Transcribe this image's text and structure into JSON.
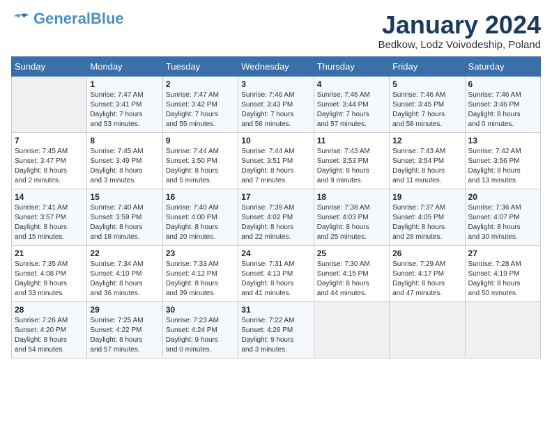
{
  "logo": {
    "general": "General",
    "blue": "Blue"
  },
  "title": "January 2024",
  "subtitle": "Bedkow, Lodz Voivodeship, Poland",
  "weekdays": [
    "Sunday",
    "Monday",
    "Tuesday",
    "Wednesday",
    "Thursday",
    "Friday",
    "Saturday"
  ],
  "weeks": [
    [
      {
        "day": "",
        "info": ""
      },
      {
        "day": "1",
        "info": "Sunrise: 7:47 AM\nSunset: 3:41 PM\nDaylight: 7 hours\nand 53 minutes."
      },
      {
        "day": "2",
        "info": "Sunrise: 7:47 AM\nSunset: 3:42 PM\nDaylight: 7 hours\nand 55 minutes."
      },
      {
        "day": "3",
        "info": "Sunrise: 7:46 AM\nSunset: 3:43 PM\nDaylight: 7 hours\nand 56 minutes."
      },
      {
        "day": "4",
        "info": "Sunrise: 7:46 AM\nSunset: 3:44 PM\nDaylight: 7 hours\nand 57 minutes."
      },
      {
        "day": "5",
        "info": "Sunrise: 7:46 AM\nSunset: 3:45 PM\nDaylight: 7 hours\nand 58 minutes."
      },
      {
        "day": "6",
        "info": "Sunrise: 7:46 AM\nSunset: 3:46 PM\nDaylight: 8 hours\nand 0 minutes."
      }
    ],
    [
      {
        "day": "7",
        "info": "Sunrise: 7:45 AM\nSunset: 3:47 PM\nDaylight: 8 hours\nand 2 minutes."
      },
      {
        "day": "8",
        "info": "Sunrise: 7:45 AM\nSunset: 3:49 PM\nDaylight: 8 hours\nand 3 minutes."
      },
      {
        "day": "9",
        "info": "Sunrise: 7:44 AM\nSunset: 3:50 PM\nDaylight: 8 hours\nand 5 minutes."
      },
      {
        "day": "10",
        "info": "Sunrise: 7:44 AM\nSunset: 3:51 PM\nDaylight: 8 hours\nand 7 minutes."
      },
      {
        "day": "11",
        "info": "Sunrise: 7:43 AM\nSunset: 3:53 PM\nDaylight: 8 hours\nand 9 minutes."
      },
      {
        "day": "12",
        "info": "Sunrise: 7:43 AM\nSunset: 3:54 PM\nDaylight: 8 hours\nand 11 minutes."
      },
      {
        "day": "13",
        "info": "Sunrise: 7:42 AM\nSunset: 3:56 PM\nDaylight: 8 hours\nand 13 minutes."
      }
    ],
    [
      {
        "day": "14",
        "info": "Sunrise: 7:41 AM\nSunset: 3:57 PM\nDaylight: 8 hours\nand 15 minutes."
      },
      {
        "day": "15",
        "info": "Sunrise: 7:40 AM\nSunset: 3:59 PM\nDaylight: 8 hours\nand 18 minutes."
      },
      {
        "day": "16",
        "info": "Sunrise: 7:40 AM\nSunset: 4:00 PM\nDaylight: 8 hours\nand 20 minutes."
      },
      {
        "day": "17",
        "info": "Sunrise: 7:39 AM\nSunset: 4:02 PM\nDaylight: 8 hours\nand 22 minutes."
      },
      {
        "day": "18",
        "info": "Sunrise: 7:38 AM\nSunset: 4:03 PM\nDaylight: 8 hours\nand 25 minutes."
      },
      {
        "day": "19",
        "info": "Sunrise: 7:37 AM\nSunset: 4:05 PM\nDaylight: 8 hours\nand 28 minutes."
      },
      {
        "day": "20",
        "info": "Sunrise: 7:36 AM\nSunset: 4:07 PM\nDaylight: 8 hours\nand 30 minutes."
      }
    ],
    [
      {
        "day": "21",
        "info": "Sunrise: 7:35 AM\nSunset: 4:08 PM\nDaylight: 8 hours\nand 33 minutes."
      },
      {
        "day": "22",
        "info": "Sunrise: 7:34 AM\nSunset: 4:10 PM\nDaylight: 8 hours\nand 36 minutes."
      },
      {
        "day": "23",
        "info": "Sunrise: 7:33 AM\nSunset: 4:12 PM\nDaylight: 8 hours\nand 39 minutes."
      },
      {
        "day": "24",
        "info": "Sunrise: 7:31 AM\nSunset: 4:13 PM\nDaylight: 8 hours\nand 41 minutes."
      },
      {
        "day": "25",
        "info": "Sunrise: 7:30 AM\nSunset: 4:15 PM\nDaylight: 8 hours\nand 44 minutes."
      },
      {
        "day": "26",
        "info": "Sunrise: 7:29 AM\nSunset: 4:17 PM\nDaylight: 8 hours\nand 47 minutes."
      },
      {
        "day": "27",
        "info": "Sunrise: 7:28 AM\nSunset: 4:19 PM\nDaylight: 8 hours\nand 50 minutes."
      }
    ],
    [
      {
        "day": "28",
        "info": "Sunrise: 7:26 AM\nSunset: 4:20 PM\nDaylight: 8 hours\nand 54 minutes."
      },
      {
        "day": "29",
        "info": "Sunrise: 7:25 AM\nSunset: 4:22 PM\nDaylight: 8 hours\nand 57 minutes."
      },
      {
        "day": "30",
        "info": "Sunrise: 7:23 AM\nSunset: 4:24 PM\nDaylight: 9 hours\nand 0 minutes."
      },
      {
        "day": "31",
        "info": "Sunrise: 7:22 AM\nSunset: 4:26 PM\nDaylight: 9 hours\nand 3 minutes."
      },
      {
        "day": "",
        "info": ""
      },
      {
        "day": "",
        "info": ""
      },
      {
        "day": "",
        "info": ""
      }
    ]
  ]
}
